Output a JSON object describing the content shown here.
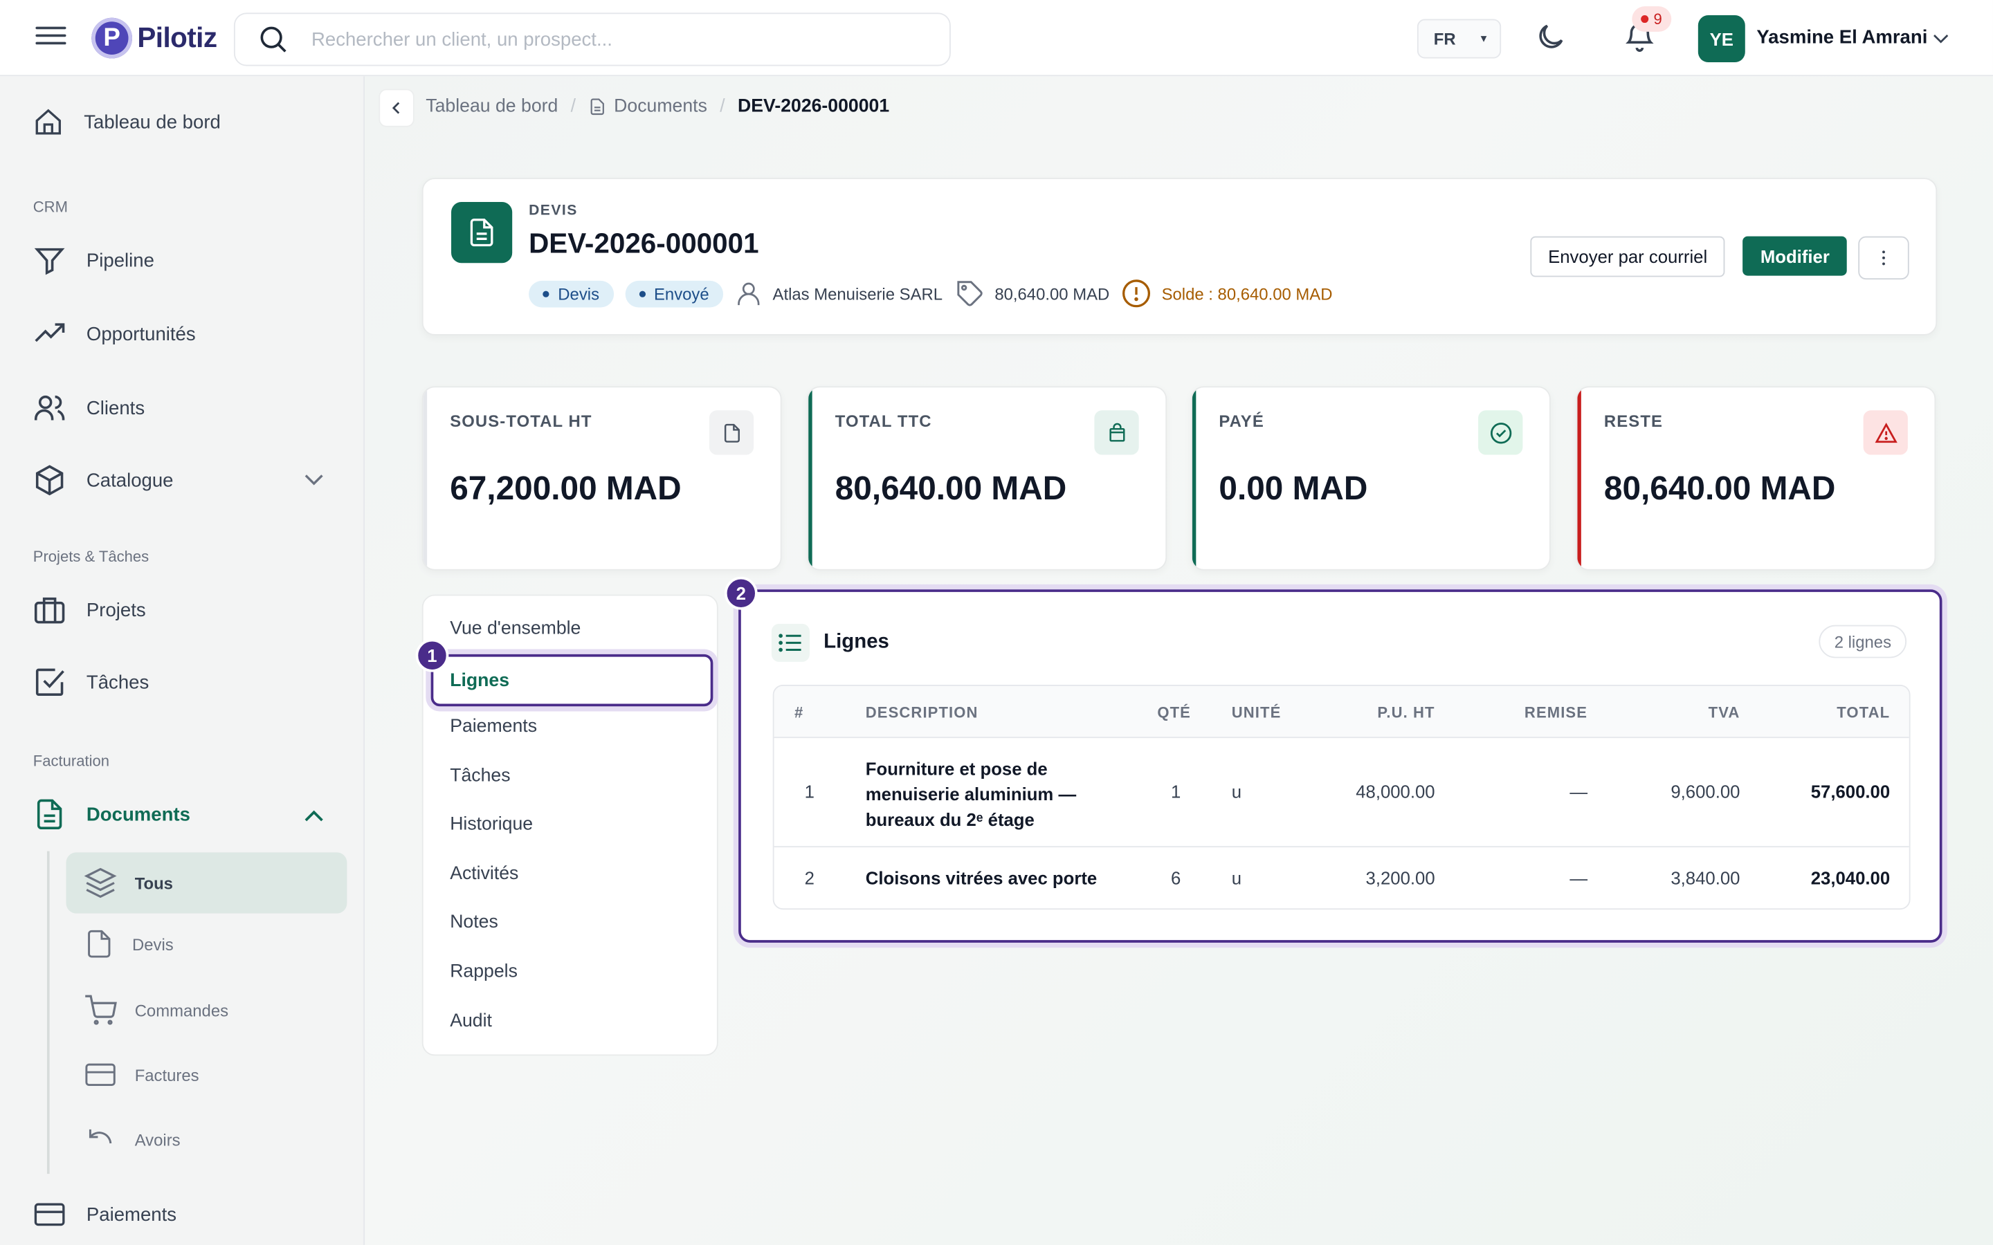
{
  "app": {
    "name": "Pilotiz",
    "logo_letter": "P"
  },
  "search": {
    "placeholder": "Rechercher un client, un prospect...",
    "value": ""
  },
  "topbar": {
    "language": "FR",
    "notifications_count": "9",
    "user_initials": "YE",
    "user_name": "Yasmine El Amrani"
  },
  "sidebar": {
    "dashboard": "Tableau de bord",
    "section_crm": "CRM",
    "pipeline": "Pipeline",
    "opportunities": "Opportunités",
    "clients": "Clients",
    "catalogue": "Catalogue",
    "section_projects": "Projets & Tâches",
    "projects": "Projets",
    "tasks": "Tâches",
    "section_billing": "Facturation",
    "documents": "Documents",
    "sub_all": "Tous",
    "sub_quotes": "Devis",
    "sub_orders": "Commandes",
    "sub_invoices": "Factures",
    "sub_credits": "Avoirs",
    "payments": "Paiements"
  },
  "breadcrumb": {
    "home": "Tableau de bord",
    "documents": "Documents",
    "current": "DEV-2026-000001"
  },
  "document": {
    "kind": "DEVIS",
    "reference": "DEV-2026-000001",
    "badge_type": "Devis",
    "badge_status": "Envoyé",
    "client": "Atlas Menuiserie SARL",
    "amount": "80,640.00 MAD",
    "balance": "Solde : 80,640.00 MAD",
    "send_label": "Envoyer par courriel",
    "edit_label": "Modifier"
  },
  "stats": [
    {
      "label": "SOUS-TOTAL HT",
      "value": "67,200.00 MAD",
      "color": "#e5e7eb"
    },
    {
      "label": "TOTAL TTC",
      "value": "80,640.00 MAD",
      "color": "#0f6b55"
    },
    {
      "label": "PAYÉ",
      "value": "0.00 MAD",
      "color": "#0f6b55"
    },
    {
      "label": "RESTE",
      "value": "80,640.00 MAD",
      "color": "#c81e1e"
    }
  ],
  "tabs": [
    "Vue d'ensemble",
    "Lignes",
    "Paiements",
    "Tâches",
    "Historique",
    "Activités",
    "Notes",
    "Rappels",
    "Audit"
  ],
  "markers": {
    "tab_marker": "1",
    "panel_marker": "2"
  },
  "lines_panel": {
    "title": "Lignes",
    "count": "2 lignes",
    "columns": [
      "#",
      "DESCRIPTION",
      "QTÉ",
      "UNITÉ",
      "P.U. HT",
      "REMISE",
      "TVA",
      "TOTAL"
    ],
    "rows": [
      {
        "num": "1",
        "desc_l1": "Fourniture et pose de",
        "desc_l2": "menuiserie aluminium —",
        "desc_l3": "bureaux du 2ᵉ étage",
        "qty": "1",
        "unit": "u",
        "unit_price": "48,000.00",
        "discount": "—",
        "vat": "9,600.00",
        "total": "57,600.00"
      },
      {
        "num": "2",
        "desc": "Cloisons vitrées avec porte",
        "qty": "6",
        "unit": "u",
        "unit_price": "3,200.00",
        "discount": "—",
        "vat": "3,840.00",
        "total": "23,040.00"
      }
    ]
  }
}
